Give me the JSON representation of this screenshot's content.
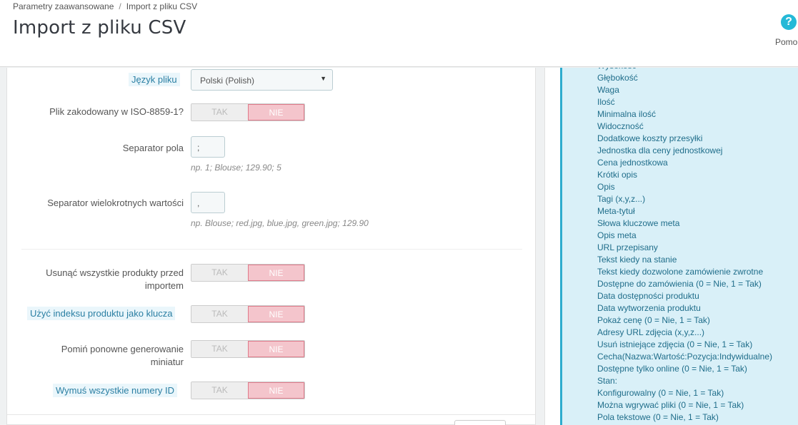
{
  "header": {
    "breadcrumb": [
      "Parametry zaawansowane",
      "Import z pliku CSV"
    ],
    "breadcrumb_sep": "/",
    "title": "Import z pliku CSV",
    "help_label": "Pomo",
    "help_icon": "?"
  },
  "form": {
    "language": {
      "label": "Język pliku",
      "value": "Polski (Polish)",
      "caret": "▼"
    },
    "iso_encoding": {
      "label": "Plik zakodowany w ISO-8859-1?",
      "yes": "TAK",
      "no": "NIE",
      "selected": "NIE"
    },
    "field_separator": {
      "label": "Separator pola",
      "value": ";",
      "hint": "np. 1; Blouse; 129.90; 5"
    },
    "multi_separator": {
      "label": "Separator wielokrotnych wartości",
      "value": ",",
      "hint": "np. Blouse; red.jpg, blue.jpg, green.jpg; 129.90"
    },
    "delete_all": {
      "label_line1": "Usunąć wszystkie produkty przed",
      "label_line2": "importem",
      "yes": "TAK",
      "no": "NIE",
      "selected": "NIE"
    },
    "use_ref_key": {
      "label": "Użyć indeksu produktu jako klucza",
      "yes": "TAK",
      "no": "NIE",
      "selected": "NIE"
    },
    "skip_thumbs": {
      "label_line1": "Pomiń ponowne generowanie",
      "label_line2": "miniatur",
      "yes": "TAK",
      "no": "NIE",
      "selected": "NIE"
    },
    "force_ids": {
      "label": "Wymuś wszystkie numery ID",
      "yes": "TAK",
      "no": "NIE",
      "selected": "NIE"
    }
  },
  "fields_list": [
    "Wysokość",
    "Głębokość",
    "Waga",
    "Ilość",
    "Minimalna ilość",
    "Widoczność",
    "Dodatkowe koszty przesyłki",
    "Jednostka dla ceny jednostkowej",
    "Cena jednostkowa",
    "Krótki opis",
    "Opis",
    "Tagi (x,y,z...)",
    "Meta-tytuł",
    "Słowa kluczowe meta",
    "Opis meta",
    "URL przepisany",
    "Tekst kiedy na stanie",
    "Tekst kiedy dozwolone zamówienie zwrotne",
    "Dostępne do zamówienia (0 = Nie, 1 = Tak)",
    "Data dostępności produktu",
    "Data wytworzenia produktu",
    "Pokaż cenę (0 = Nie, 1 = Tak)",
    "Adresy URL zdjęcia (x,y,z...)",
    "Usuń istniejące zdjęcia (0 = Nie, 1 = Tak)",
    "Cecha(Nazwa:Wartość:Pozycja:Indywidualne)",
    "Dostępne tylko online (0 = Nie, 1 = Tak)",
    "Stan:",
    "Konfigurowalny (0 = Nie, 1 = Tak)",
    "Można wgrywać pliki (0 = Nie, 1 = Tak)",
    "Pola tekstowe (0 = Nie, 1 = Tak)"
  ],
  "colors": {
    "accent": "#25b9d7",
    "no_selected_bg": "#f4c5cc",
    "list_bg": "#d9f0f8",
    "list_text": "#1f6d8a"
  }
}
